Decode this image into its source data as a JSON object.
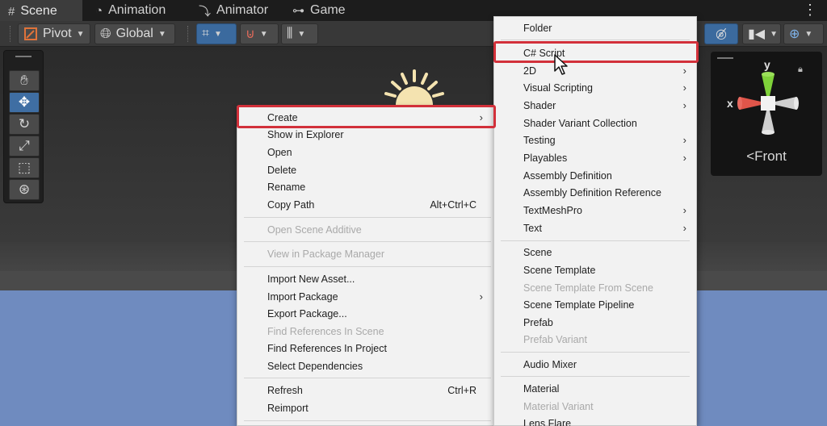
{
  "tabs": [
    {
      "label": "Scene",
      "icon": "hash-icon",
      "active": true
    },
    {
      "label": "Animation",
      "icon": "clock-icon",
      "active": false
    },
    {
      "label": "Animator",
      "icon": "animator-icon",
      "active": false
    },
    {
      "label": "Game",
      "icon": "gamepad-icon",
      "active": false
    }
  ],
  "toolbar": {
    "pivot_label": "Pivot",
    "global_label": "Global"
  },
  "gizmo": {
    "y_label": "y",
    "x_label": "x",
    "view_label": "Front",
    "colors": {
      "y": "#7fd23a",
      "x": "#e0554a",
      "neutral": "#d9d9d9"
    }
  },
  "context_menu": {
    "items": [
      {
        "label": "Create",
        "submenu": true,
        "highlighted": true
      },
      {
        "label": "Show in Explorer"
      },
      {
        "label": "Open"
      },
      {
        "label": "Delete"
      },
      {
        "label": "Rename"
      },
      {
        "label": "Copy Path",
        "shortcut": "Alt+Ctrl+C"
      },
      {
        "label": "Open Scene Additive",
        "disabled": true
      },
      {
        "label": "View in Package Manager",
        "disabled": true
      },
      {
        "label": "Import New Asset..."
      },
      {
        "label": "Import Package",
        "submenu": true
      },
      {
        "label": "Export Package..."
      },
      {
        "label": "Find References In Scene",
        "disabled": true
      },
      {
        "label": "Find References In Project"
      },
      {
        "label": "Select Dependencies"
      },
      {
        "label": "Refresh",
        "shortcut": "Ctrl+R"
      },
      {
        "label": "Reimport"
      }
    ]
  },
  "create_submenu": {
    "items": [
      {
        "label": "Folder"
      },
      {
        "label": "C# Script",
        "highlighted": true
      },
      {
        "label": "2D",
        "submenu": true
      },
      {
        "label": "Visual Scripting",
        "submenu": true
      },
      {
        "label": "Shader",
        "submenu": true
      },
      {
        "label": "Shader Variant Collection"
      },
      {
        "label": "Testing",
        "submenu": true
      },
      {
        "label": "Playables",
        "submenu": true
      },
      {
        "label": "Assembly Definition"
      },
      {
        "label": "Assembly Definition Reference"
      },
      {
        "label": "TextMeshPro",
        "submenu": true
      },
      {
        "label": "Text",
        "submenu": true
      },
      {
        "label": "Scene"
      },
      {
        "label": "Scene Template"
      },
      {
        "label": "Scene Template From Scene",
        "disabled": true
      },
      {
        "label": "Scene Template Pipeline"
      },
      {
        "label": "Prefab"
      },
      {
        "label": "Prefab Variant",
        "disabled": true
      },
      {
        "label": "Audio Mixer"
      },
      {
        "label": "Material"
      },
      {
        "label": "Material Variant",
        "disabled": true
      },
      {
        "label": "Lens Flare"
      }
    ]
  },
  "colors": {
    "highlight_outline": "#d2303a",
    "selected_tool": "#3f6ea3",
    "floor": "#6f8bbf"
  }
}
